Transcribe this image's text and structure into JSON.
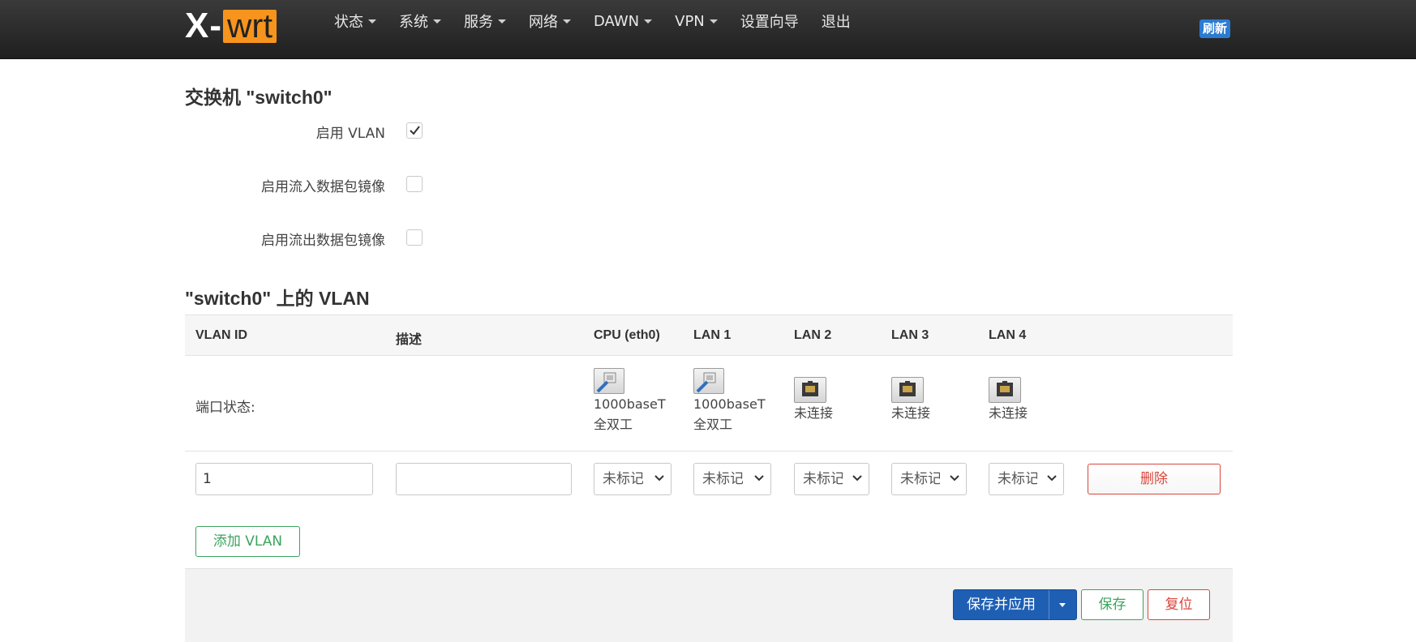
{
  "nav": {
    "logo_x": "X",
    "logo_dash": "-",
    "logo_wrt": "wrt",
    "menu": [
      {
        "label": "状态",
        "dropdown": true
      },
      {
        "label": "系统",
        "dropdown": true
      },
      {
        "label": "服务",
        "dropdown": true
      },
      {
        "label": "网络",
        "dropdown": true
      },
      {
        "label": "DAWN",
        "dropdown": true
      },
      {
        "label": "VPN",
        "dropdown": true
      },
      {
        "label": "设置向导",
        "dropdown": false
      },
      {
        "label": "退出",
        "dropdown": false
      }
    ],
    "refresh": "刷新",
    "accent_color": "#f7941d"
  },
  "switch": {
    "title": "交换机 \"switch0\"",
    "enable_vlan_label": "启用 VLAN",
    "enable_vlan_checked": true,
    "ingress_mirror_label": "启用流入数据包镜像",
    "ingress_mirror_checked": false,
    "egress_mirror_label": "启用流出数据包镜像",
    "egress_mirror_checked": false
  },
  "vlan": {
    "title": "\"switch0\" 上的 VLAN",
    "headers": {
      "vlan_id": "VLAN ID",
      "desc": "描述",
      "cpu": "CPU (eth0)",
      "lan1": "LAN 1",
      "lan2": "LAN 2",
      "lan3": "LAN 3",
      "lan4": "LAN 4"
    },
    "port_status_label": "端口状态:",
    "ports": {
      "cpu": {
        "line1": "1000baseT",
        "line2": "全双工",
        "connected": true
      },
      "lan1": {
        "line1": "1000baseT",
        "line2": "全双工",
        "connected": true
      },
      "lan2": {
        "line1": "未连接",
        "connected": false
      },
      "lan3": {
        "line1": "未连接",
        "connected": false
      },
      "lan4": {
        "line1": "未连接",
        "connected": false
      }
    },
    "row": {
      "vlan_id": "1",
      "desc": "",
      "cpu": "未标记",
      "lan1": "未标记",
      "lan2": "未标记",
      "lan3": "未标记",
      "lan4": "未标记"
    },
    "delete_label": "删除",
    "add_label": "添加 VLAN"
  },
  "footer": {
    "save_apply": "保存并应用",
    "save": "保存",
    "reset": "复位"
  }
}
